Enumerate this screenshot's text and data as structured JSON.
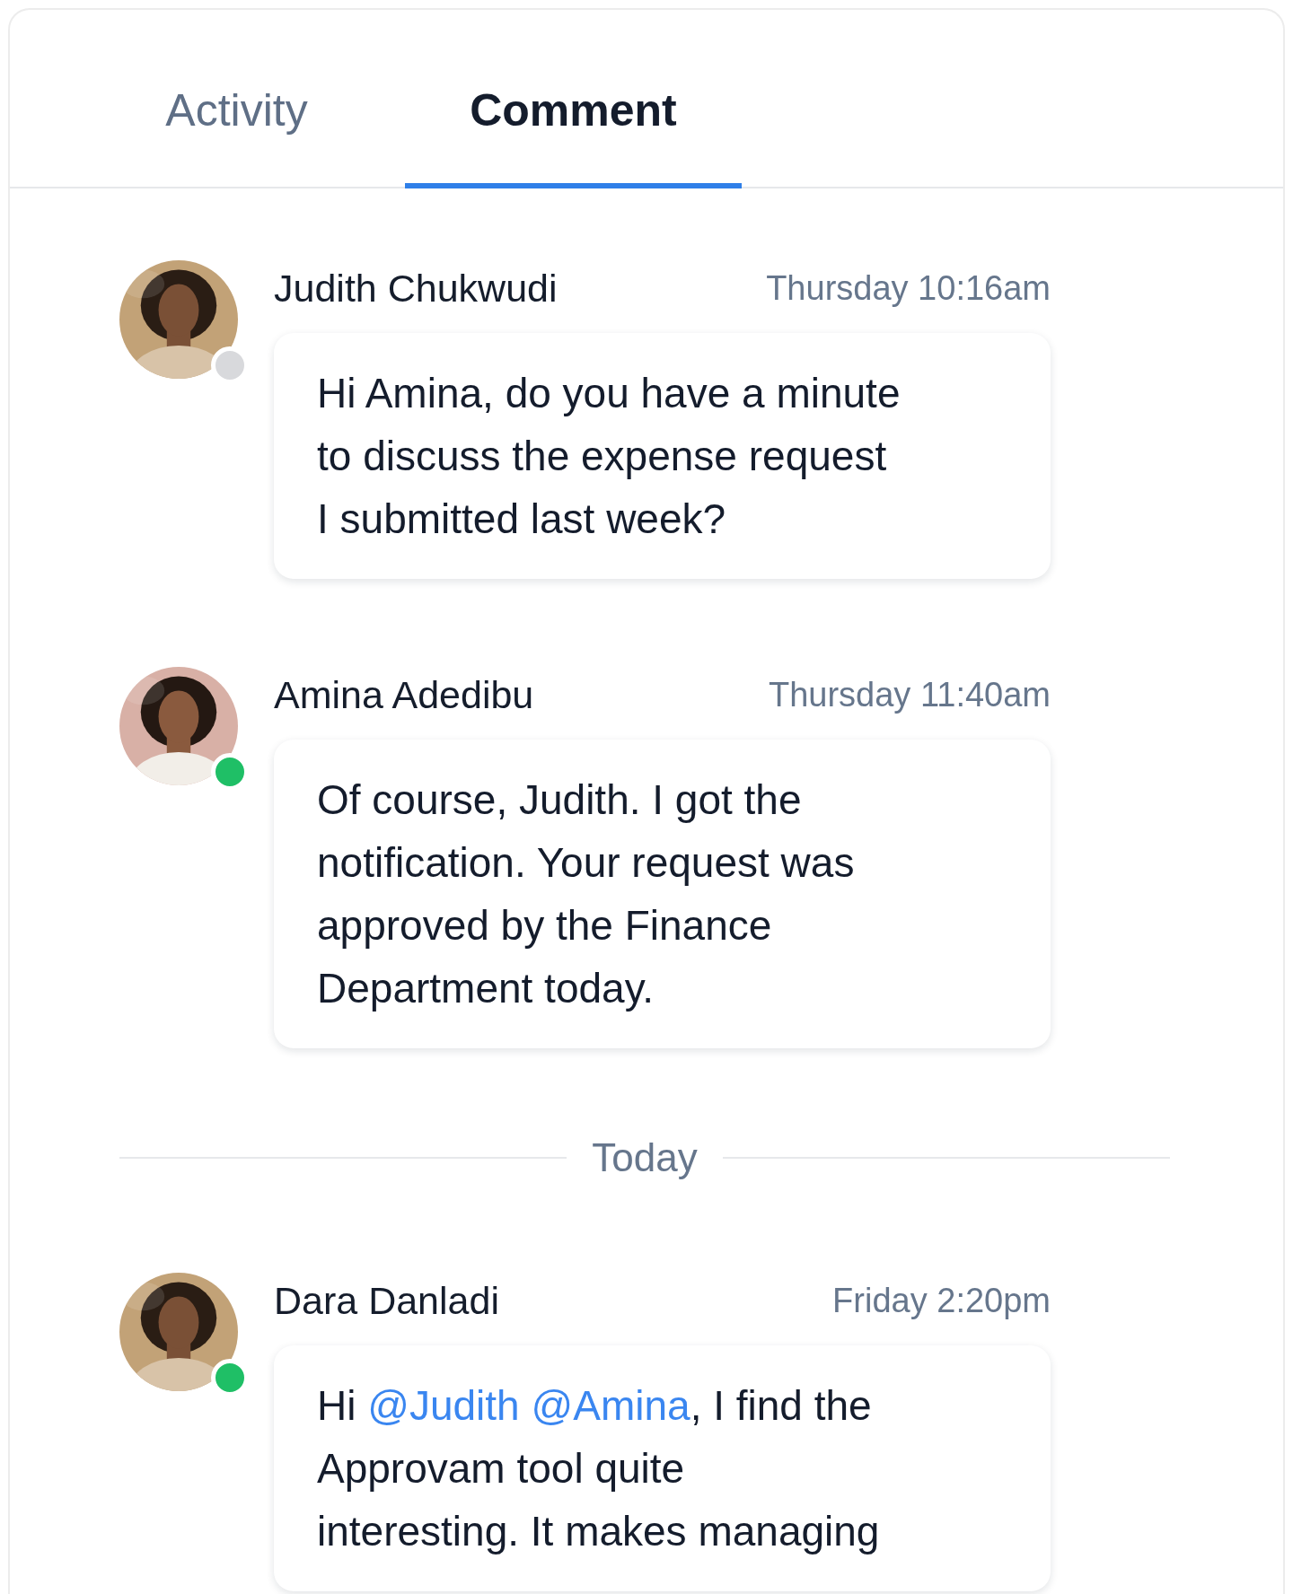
{
  "tabs": [
    {
      "label": "Activity",
      "selected": false
    },
    {
      "label": "Comment",
      "selected": true
    }
  ],
  "feed": [
    {
      "kind": "message",
      "author": "Judith Chukwudi",
      "time": "Thursday 10:16am",
      "online": false,
      "avatar": {
        "kind": "picture"
      },
      "parts": [
        {
          "kind": "text",
          "text": "Hi Amina, do you have a minute\nto discuss the expense request\nI submitted last week?"
        }
      ]
    },
    {
      "kind": "message",
      "author": "Amina Adedibu",
      "time": "Thursday 11:40am",
      "online": true,
      "avatar": {
        "kind": "picture"
      },
      "parts": [
        {
          "kind": "text",
          "text": "Of course, Judith. I got the\nnotification. Your request was\napproved by the Finance\nDepartment today."
        }
      ]
    },
    {
      "kind": "divider",
      "label": "Today"
    },
    {
      "kind": "message",
      "author": "Dara Danladi",
      "time": "Friday 2:20pm",
      "online": true,
      "avatar": {
        "kind": "picture"
      },
      "parts": [
        {
          "kind": "text",
          "text": "Hi "
        },
        {
          "kind": "mention",
          "text": "@Judith"
        },
        {
          "kind": "mention",
          "text": "@Amina"
        },
        {
          "kind": "text",
          "text": ", I find the\nApprovam tool quite\ninteresting. It makes managing"
        }
      ]
    }
  ]
}
